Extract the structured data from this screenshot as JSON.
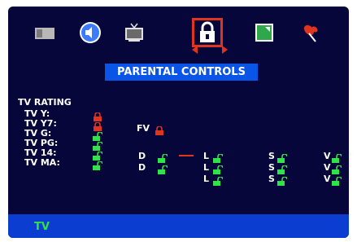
{
  "menu": {
    "icons": [
      {
        "name": "camera-icon"
      },
      {
        "name": "speaker-icon"
      },
      {
        "name": "tv-icon"
      },
      {
        "name": "lock-icon"
      },
      {
        "name": "picture-icon"
      },
      {
        "name": "pin-icon"
      }
    ],
    "selected": "lock-icon"
  },
  "panel": {
    "title": "PARENTAL CONTROLS",
    "section": "TV RATING",
    "ratings": [
      {
        "label": "TV  Y:",
        "locked": true
      },
      {
        "label": "TV  Y7:",
        "locked": true
      },
      {
        "label": "TV  G:",
        "locked": false
      },
      {
        "label": "TV  PG:",
        "locked": false
      },
      {
        "label": "TV  14:",
        "locked": false
      },
      {
        "label": "TV  MA:",
        "locked": false
      }
    ],
    "fv_label": "FV",
    "d_label": "D",
    "l_label": "L",
    "s_label": "S",
    "v_label": "V"
  },
  "status_bar": {
    "text": "TV"
  },
  "colors": {
    "background": "#06063a",
    "title_bar": "#0a55e6",
    "status_bar": "#0a3dd0",
    "locked": "#e0341f",
    "unlocked": "#30e34a"
  }
}
